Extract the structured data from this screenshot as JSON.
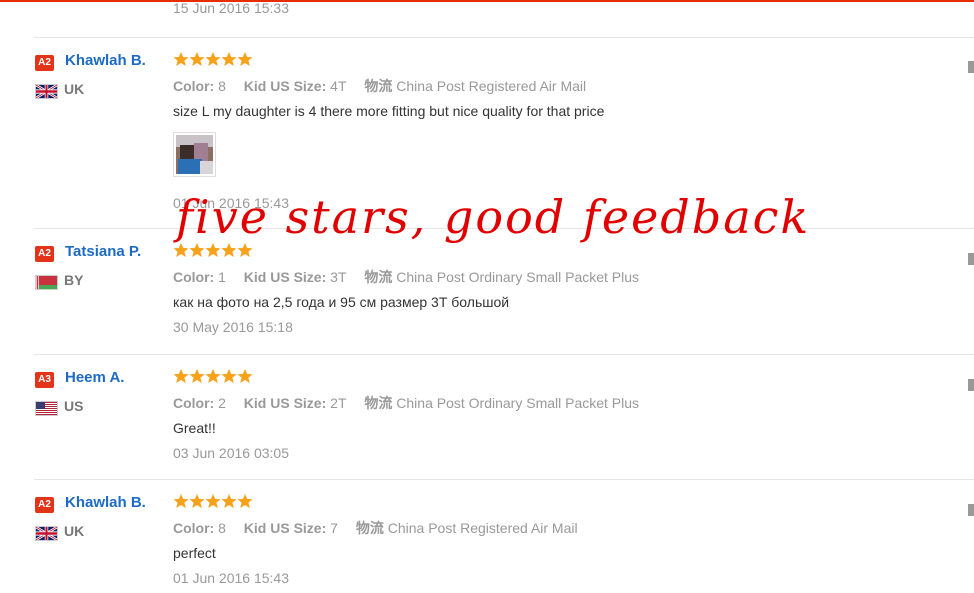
{
  "previous": {
    "date": "15 Jun 2016 15:33"
  },
  "labels": {
    "color": "Color:",
    "size": "Kid US Size:",
    "logistics": "物流"
  },
  "reviews": [
    {
      "level": "A2",
      "name": "Khawlah B.",
      "country": "UK",
      "flag": "uk",
      "rating": 5,
      "color": "8",
      "size": "4T",
      "shipping": "China Post Registered Air Mail",
      "text": "size L my daughter is 4 there more fitting but nice quality for that price",
      "date": "01 Jun 2016 15:43"
    },
    {
      "level": "A2",
      "name": "Tatsiana P.",
      "country": "BY",
      "flag": "by",
      "rating": 5,
      "color": "1",
      "size": "3T",
      "shipping": "China Post Ordinary Small Packet Plus",
      "text": "как на фото на 2,5 года и 95 см размер 3Т большой",
      "date": "30 May 2016 15:18"
    },
    {
      "level": "A3",
      "name": "Heem A.",
      "country": "US",
      "flag": "us",
      "rating": 5,
      "color": "2",
      "size": "2T",
      "shipping": "China Post Ordinary Small Packet Plus",
      "text": "Great!!",
      "date": "03 Jun 2016 03:05"
    },
    {
      "level": "A2",
      "name": "Khawlah B.",
      "country": "UK",
      "flag": "uk",
      "rating": 5,
      "color": "8",
      "size": "7",
      "shipping": "China Post Registered Air Mail",
      "text": "perfect",
      "date": "01 Jun 2016 15:43"
    }
  ],
  "overlay": {
    "text": "five stars, good feedback"
  },
  "colors": {
    "accent": "#e62e04",
    "star": "#f7a21b",
    "name": "#1d6bc4",
    "badge": "#e3341a",
    "overlay": "#e00000"
  }
}
